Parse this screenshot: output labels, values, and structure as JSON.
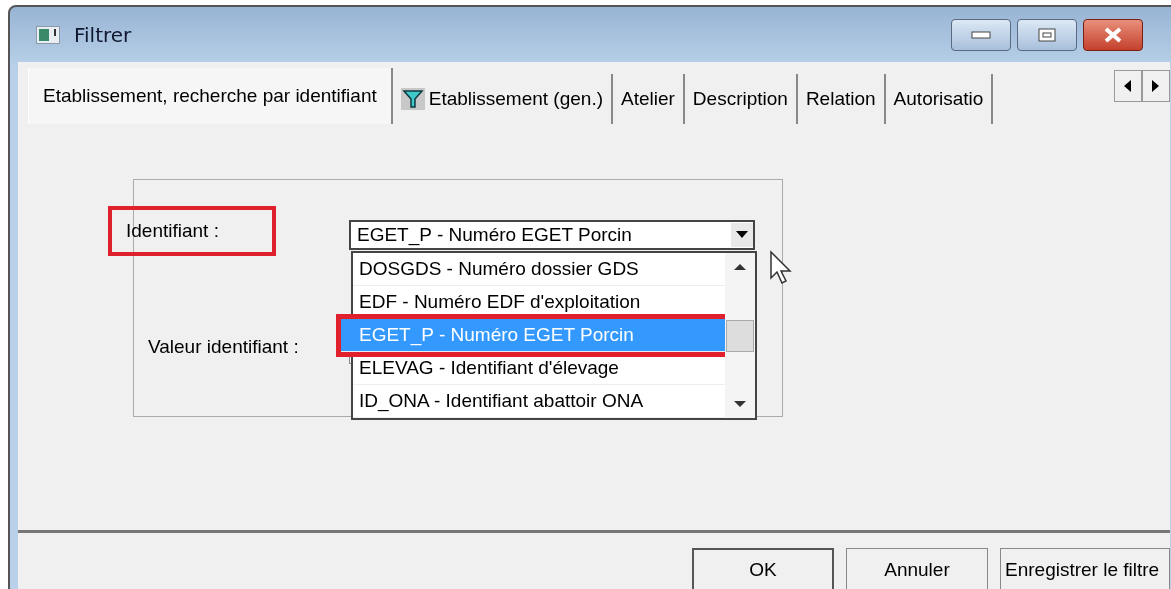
{
  "window": {
    "title": "Filtrer"
  },
  "tabs": [
    {
      "label": "Etablissement, recherche par identifiant",
      "selected": true,
      "filter": false
    },
    {
      "label": "Etablissement (gen.)",
      "selected": false,
      "filter": true
    },
    {
      "label": "Atelier",
      "selected": false,
      "filter": false
    },
    {
      "label": "Description",
      "selected": false,
      "filter": false
    },
    {
      "label": "Relation",
      "selected": false,
      "filter": false
    },
    {
      "label": "Autorisatio",
      "selected": false,
      "filter": false
    }
  ],
  "form": {
    "identifiant": {
      "label": "Identifiant :",
      "highlighted": true,
      "value": "EGET_P - Numéro EGET Porcin",
      "options": [
        {
          "label": "DOSGDS - Numéro dossier GDS",
          "selected": false,
          "highlighted": false
        },
        {
          "label": "EDF - Numéro EDF d'exploitation",
          "selected": false,
          "highlighted": false
        },
        {
          "label": "EGET_P - Numéro EGET Porcin",
          "selected": true,
          "highlighted": true
        },
        {
          "label": "ELEVAG - Identifiant d'élevage",
          "selected": false,
          "highlighted": false
        },
        {
          "label": "ID_ONA - Identifiant abattoir ONA",
          "selected": false,
          "highlighted": false
        }
      ]
    },
    "valeur": {
      "label": "Valeur identifiant :"
    }
  },
  "buttons": [
    {
      "label": "OK",
      "default": true
    },
    {
      "label": "Annuler",
      "default": false
    },
    {
      "label": "Enregistrer le filtre",
      "default": false
    }
  ]
}
